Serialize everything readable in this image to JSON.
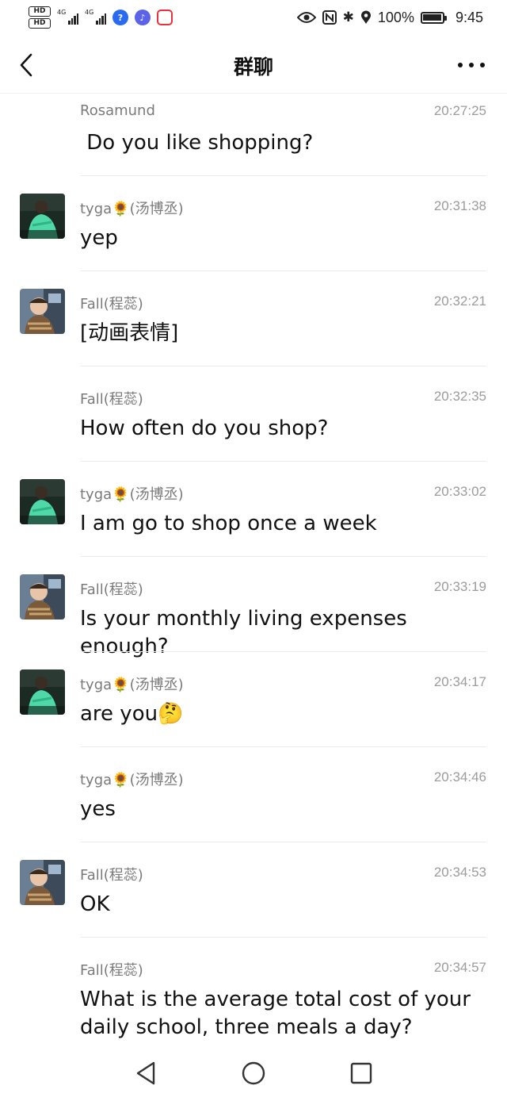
{
  "status_bar": {
    "hd1": "HD",
    "hd2": "HD",
    "net1": "4G",
    "net2": "4G",
    "battery": "100%",
    "time": "9:45",
    "icons": [
      "eye-icon",
      "nfc-icon",
      "bluetooth-icon",
      "location-icon",
      "battery-icon"
    ]
  },
  "header": {
    "title": "群聊"
  },
  "messages": [
    {
      "sender": "Rosamund",
      "time": "20:27:25",
      "text": " Do you like shopping?",
      "avatar": "none"
    },
    {
      "sender": "tyga🌻(汤博丞)",
      "time": "20:31:38",
      "text": "yep",
      "avatar": "tyga"
    },
    {
      "sender": "Fall(程蕊)",
      "time": "20:32:21",
      "text": "[动画表情]",
      "avatar": "fall"
    },
    {
      "sender": "Fall(程蕊)",
      "time": "20:32:35",
      "text": "How often do you shop?",
      "avatar": "none"
    },
    {
      "sender": "tyga🌻(汤博丞)",
      "time": "20:33:02",
      "text": "I am go to shop once a week",
      "avatar": "tyga"
    },
    {
      "sender": "Fall(程蕊)",
      "time": "20:33:19",
      "text": "Is your monthly living expenses enough?",
      "avatar": "fall"
    },
    {
      "sender": "tyga🌻(汤博丞)",
      "time": "20:34:17",
      "text": "are you🤔",
      "avatar": "tyga"
    },
    {
      "sender": "tyga🌻(汤博丞)",
      "time": "20:34:46",
      "text": "yes",
      "avatar": "none"
    },
    {
      "sender": "Fall(程蕊)",
      "time": "20:34:53",
      "text": "OK",
      "avatar": "fall"
    },
    {
      "sender": "Fall(程蕊)",
      "time": "20:34:57",
      "text": "What is the average total cost of your daily school, three meals a day?",
      "avatar": "none"
    }
  ],
  "colors": {
    "text": "#111111",
    "meta": "#7a7a7a",
    "time": "#9c9c9c",
    "divider": "#ececec"
  }
}
